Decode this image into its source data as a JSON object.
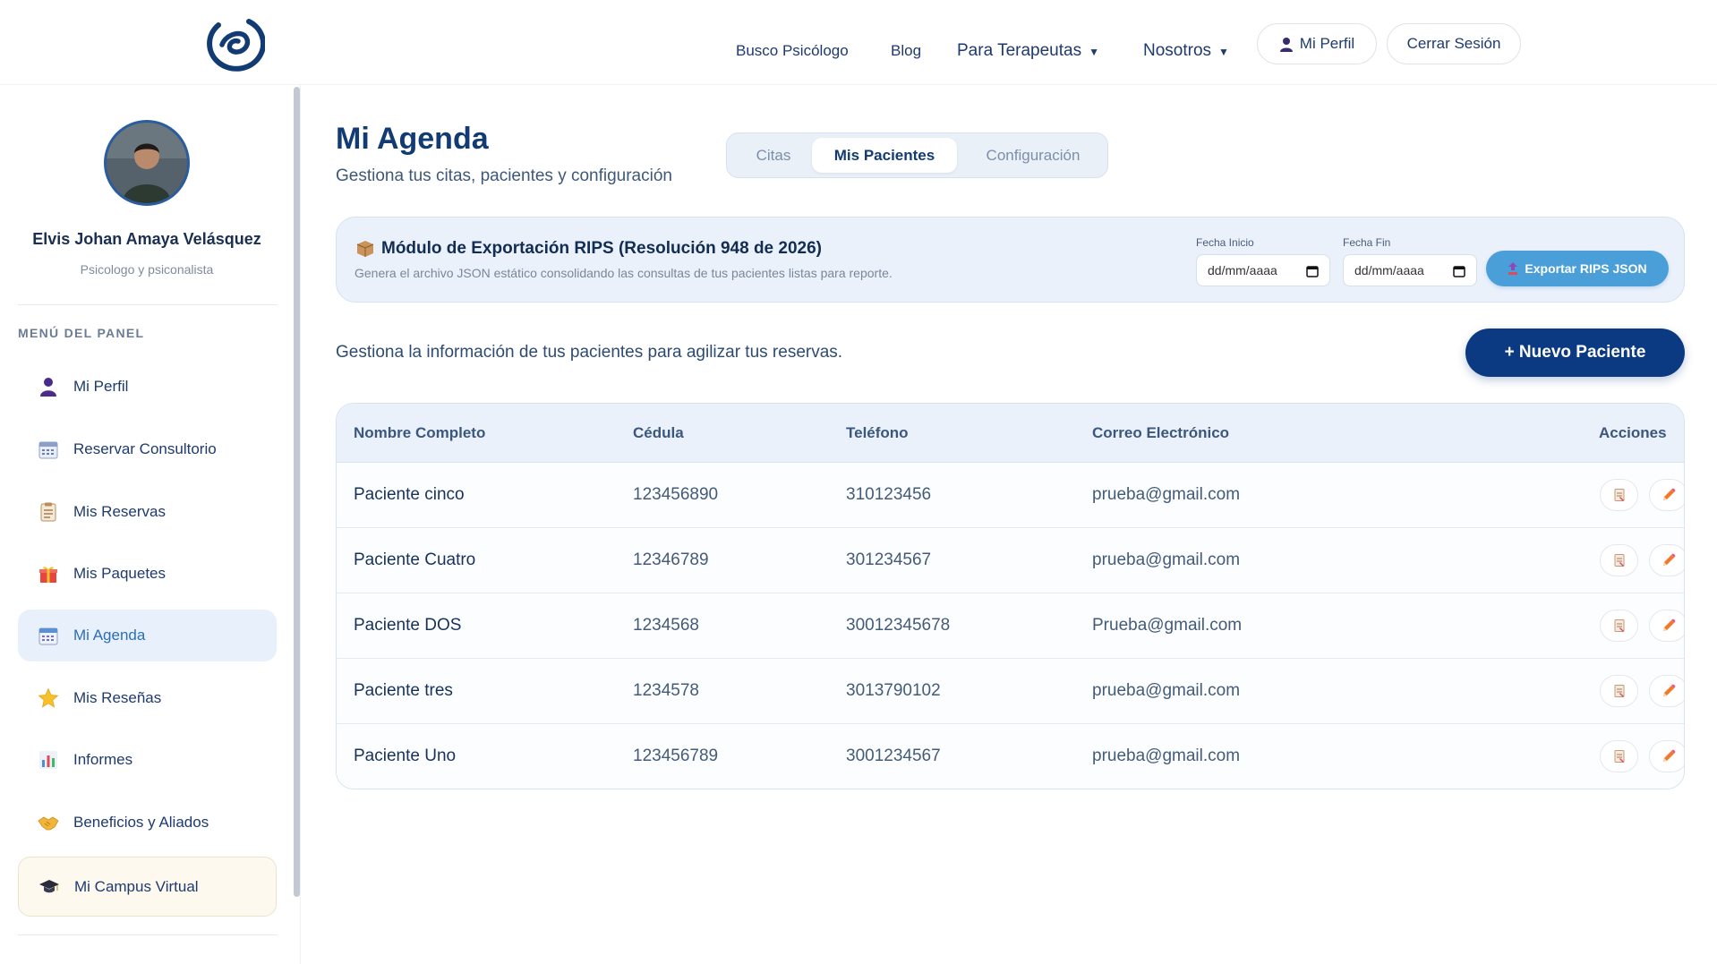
{
  "nav": {
    "links": [
      "Busco Psicólogo",
      "Blog"
    ],
    "dropdowns": [
      "Para Terapeutas",
      "Nosotros"
    ],
    "profile_button": "Mi Perfil",
    "logout_button": "Cerrar Sesión"
  },
  "sidebar": {
    "name": "Elvis Johan Amaya Velásquez",
    "role": "Psicologo y psiconalista",
    "menu_heading": "MENÚ DEL PANEL",
    "items": [
      {
        "label": "Mi Perfil",
        "icon": "user-icon"
      },
      {
        "label": "Reservar Consultorio",
        "icon": "calendar-icon"
      },
      {
        "label": "Mis Reservas",
        "icon": "clipboard-icon"
      },
      {
        "label": "Mis Paquetes",
        "icon": "gift-icon"
      },
      {
        "label": "Mi Agenda",
        "icon": "calendar-icon",
        "active": true
      },
      {
        "label": "Mis Reseñas",
        "icon": "star-icon"
      },
      {
        "label": "Informes",
        "icon": "bar-chart-icon"
      },
      {
        "label": "Beneficios y Aliados",
        "icon": "handshake-icon"
      },
      {
        "label": "Mi Campus Virtual",
        "icon": "graduation-cap-icon"
      }
    ]
  },
  "page": {
    "title": "Mi Agenda",
    "subtitle": "Gestiona tus citas, pacientes y configuración",
    "tabs": [
      {
        "label": "Citas"
      },
      {
        "label": "Mis Pacientes",
        "active": true
      },
      {
        "label": "Configuración"
      }
    ]
  },
  "rips": {
    "title": "Módulo de Exportación RIPS (Resolución 948 de 2026)",
    "description": "Genera el archivo JSON estático consolidando las consultas de tus pacientes listas para reporte.",
    "start_label": "Fecha Inicio",
    "end_label": "Fecha Fin",
    "date_placeholder": "dd/mm/aaaa",
    "export_button": "Exportar RIPS JSON"
  },
  "patients": {
    "intro": "Gestiona la información de tus pacientes para agilizar tus reservas.",
    "new_button": "+  Nuevo Paciente",
    "columns": [
      "Nombre Completo",
      "Cédula",
      "Teléfono",
      "Correo Electrónico",
      "Acciones"
    ],
    "rows": [
      {
        "name": "Paciente cinco",
        "cedula": "123456890",
        "telefono": "310123456",
        "email": "prueba@gmail.com"
      },
      {
        "name": "Paciente Cuatro",
        "cedula": "12346789",
        "telefono": "301234567",
        "email": "prueba@gmail.com"
      },
      {
        "name": "Paciente DOS",
        "cedula": "1234568",
        "telefono": "30012345678",
        "email": "Prueba@gmail.com"
      },
      {
        "name": "Paciente tres",
        "cedula": "1234578",
        "telefono": "3013790102",
        "email": "prueba@gmail.com"
      },
      {
        "name": "Paciente Uno",
        "cedula": "123456789",
        "telefono": "3001234567",
        "email": "prueba@gmail.com"
      }
    ],
    "actions": [
      "document-icon",
      "pencil-icon",
      "trash-icon"
    ]
  },
  "colors": {
    "primary": "#0c3a82",
    "accent": "#4a9fd8",
    "active_menu": "#e8f1fb"
  }
}
